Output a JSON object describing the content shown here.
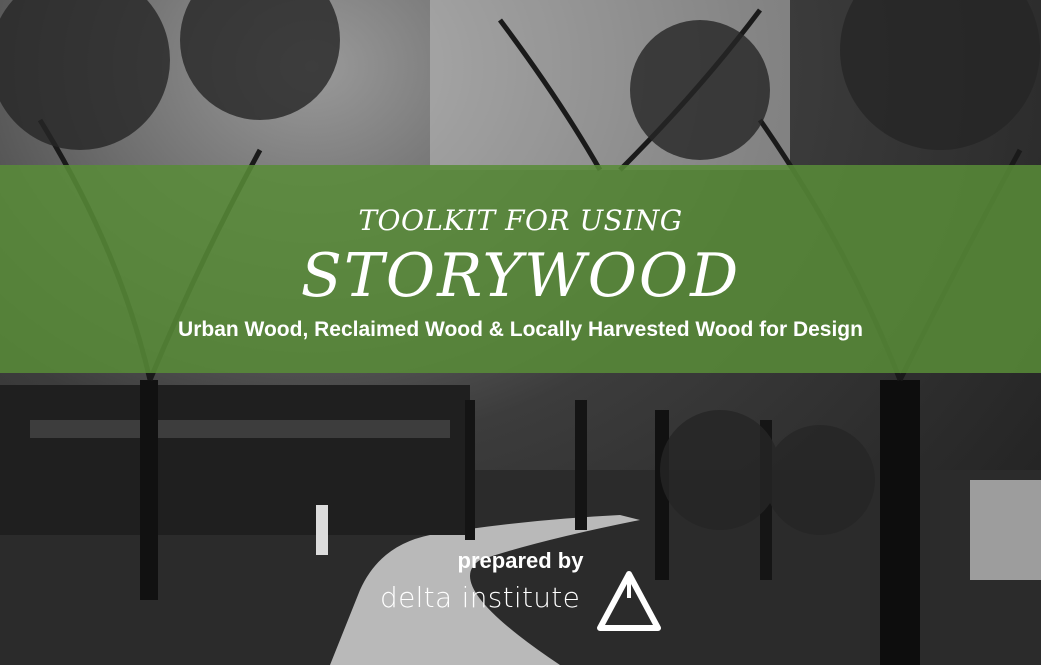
{
  "cover": {
    "eyebrow": "TOOLKIT FOR USING",
    "title": "STORYWOOD",
    "subtitle": "Urban Wood, Reclaimed Wood & Locally Harvested Wood for Design",
    "prepared_by": "prepared by",
    "organization": "delta institute",
    "logo_icon": "delta-triangle-icon",
    "band_color": "#588c38"
  }
}
